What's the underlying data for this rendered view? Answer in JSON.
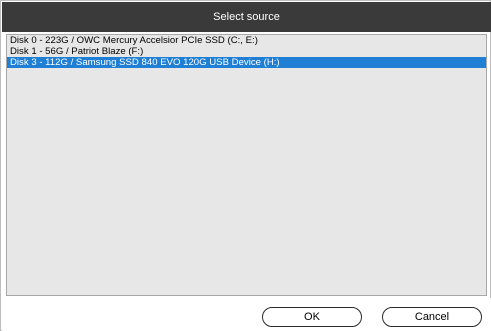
{
  "dialog": {
    "title": "Select source"
  },
  "sources": [
    {
      "label": "Disk 0 - 223G / OWC Mercury Accelsior PCIe SSD (C:, E:)",
      "selected": false
    },
    {
      "label": "Disk 1 - 56G / Patriot Blaze (F:)",
      "selected": false
    },
    {
      "label": "Disk 3 - 112G / Samsung SSD 840 EVO 120G USB Device (H:)",
      "selected": true
    }
  ],
  "buttons": {
    "ok_label": "OK",
    "cancel_label": "Cancel"
  },
  "colors": {
    "titlebar": "#3a3a3a",
    "selection": "#1e7fd4",
    "list_background": "#e7e7e7"
  }
}
